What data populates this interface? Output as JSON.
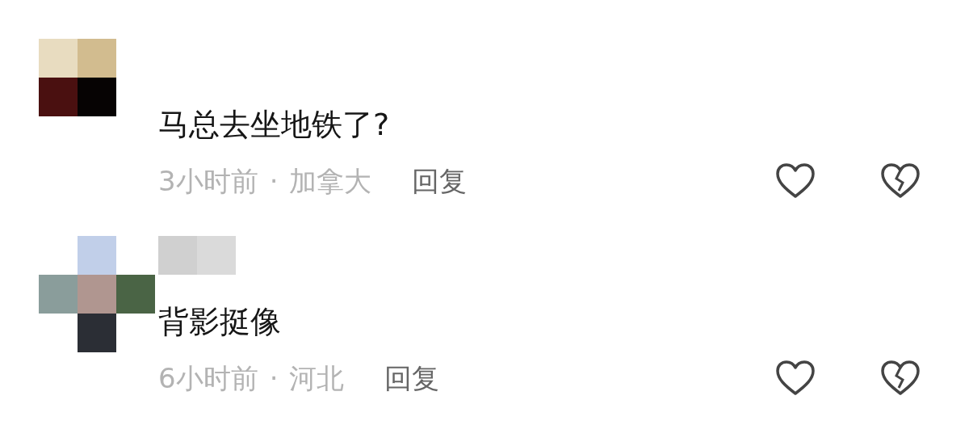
{
  "comments": [
    {
      "text": "马总去坐地铁了?",
      "time": "3小时前",
      "separator": "·",
      "location": "加拿大",
      "reply": "回复"
    },
    {
      "text": "背影挺像",
      "time": "6小时前",
      "separator": "·",
      "location": "河北",
      "reply": "回复"
    }
  ]
}
